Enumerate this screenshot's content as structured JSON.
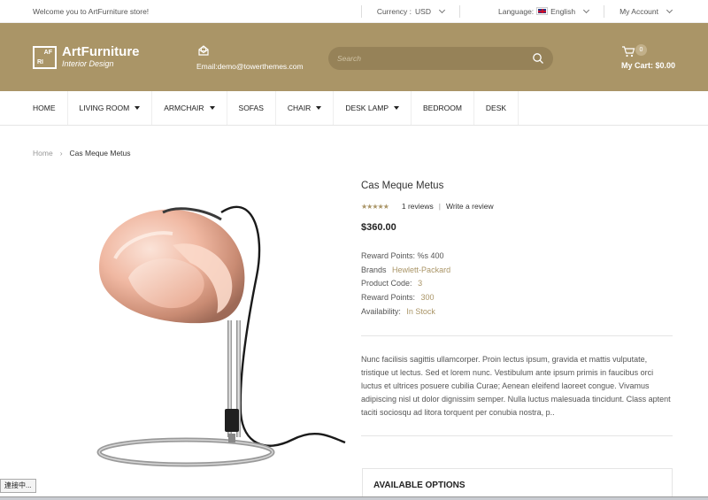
{
  "topbar": {
    "welcome": "Welcome you to ArtFurniture store!",
    "currency_label": "Currency :",
    "currency_value": "USD",
    "language_label": "Language:",
    "language_value": "English",
    "account_label": "My Account"
  },
  "header": {
    "logo_title": "ArtFurniture",
    "logo_subtitle": "Interior Design",
    "logo_mark_top": "AF",
    "logo_mark_bottom": "RI",
    "email": "Email:demo@towerthemes.com",
    "search_placeholder": "Search",
    "cart_count": "0",
    "cart_label": "My Cart: $0.00",
    "band_color": "#aa9567"
  },
  "nav": {
    "items": [
      {
        "label": "HOME",
        "has_dropdown": false
      },
      {
        "label": "LIVING ROOM",
        "has_dropdown": true
      },
      {
        "label": "ARMCHAIR",
        "has_dropdown": true
      },
      {
        "label": "SOFAS",
        "has_dropdown": false
      },
      {
        "label": "CHAIR",
        "has_dropdown": true
      },
      {
        "label": "DESK LAMP",
        "has_dropdown": true
      },
      {
        "label": "BEDROOM",
        "has_dropdown": false
      },
      {
        "label": "DESK",
        "has_dropdown": false
      }
    ]
  },
  "breadcrumb": {
    "home": "Home",
    "separator": "›",
    "current": "Cas Meque Metus"
  },
  "product": {
    "title": "Cas Meque Metus",
    "stars": "★★★★★",
    "reviews": "1 reviews",
    "divider": "|",
    "write_review": "Write a review",
    "price": "$360.00",
    "reward_points_line": "Reward Points: %s 400",
    "brands_label": "Brands",
    "brands_value": "Hewlett-Packard",
    "code_label": "Product Code:",
    "code_value": "3",
    "reward_label": "Reward Points:",
    "reward_value": "300",
    "availability_label": "Availability:",
    "availability_value": "In Stock",
    "description": "Nunc facilisis sagittis ullamcorper. Proin lectus ipsum, gravida et mattis vulputate, tristique ut lectus. Sed et lorem nunc. Vestibulum ante ipsum primis in faucibus orci luctus et ultrices posuere cubilia Curae; Aenean eleifend laoreet congue. Vivamus adipiscing nisl ut dolor dignissim semper. Nulla luctus malesuada tincidunt. Class aptent taciti sociosqu ad litora torquent per conubia nostra, p..",
    "options_title": "AVAILABLE OPTIONS",
    "accent_color": "#aa9567"
  },
  "status": {
    "tooltip": "連接中..."
  }
}
